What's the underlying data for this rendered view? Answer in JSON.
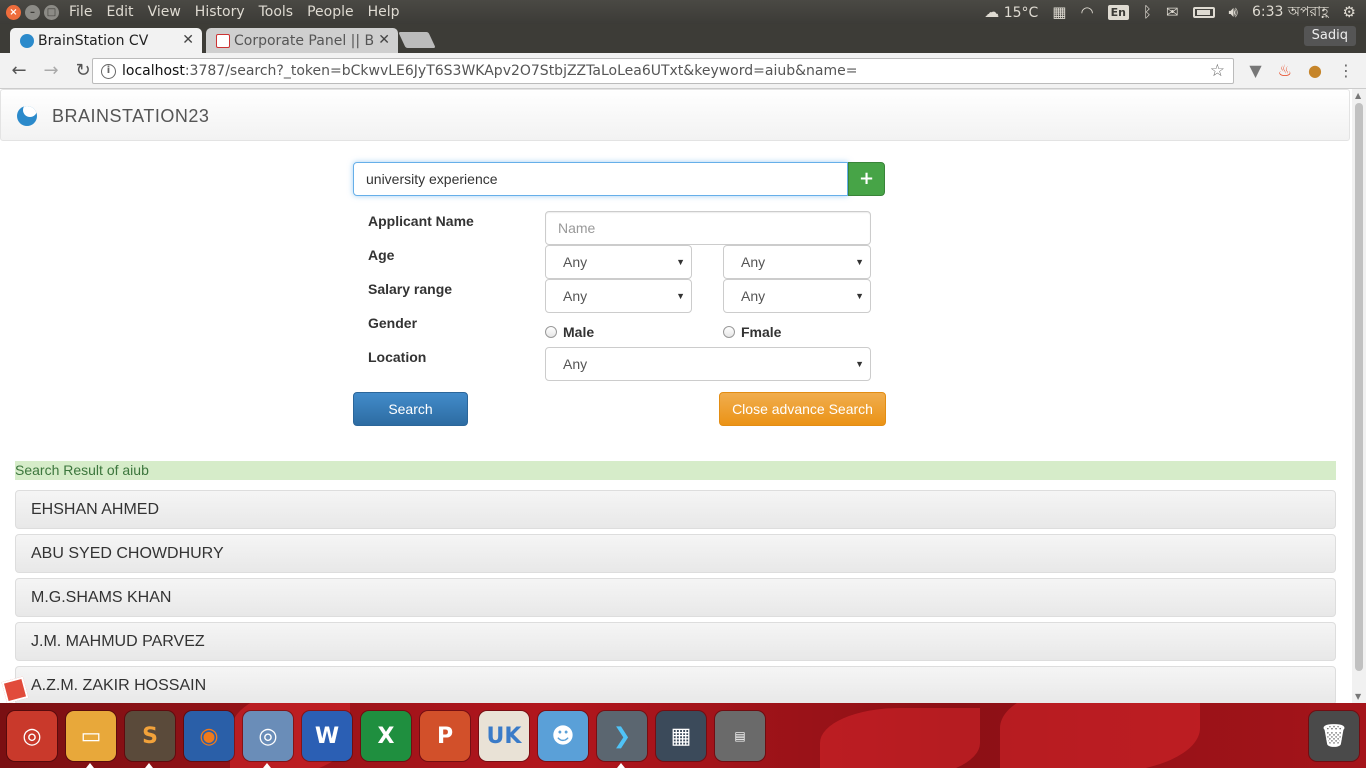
{
  "system": {
    "menus": [
      "File",
      "Edit",
      "View",
      "History",
      "Tools",
      "People",
      "Help"
    ],
    "weather": "15°C",
    "lang": "En",
    "time": "6:33 অপরাহ্ণ"
  },
  "browser": {
    "tabs": [
      {
        "title": "BrainStation CV",
        "active": true
      },
      {
        "title": "Corporate Panel || B",
        "active": false
      }
    ],
    "profile": "Sadiq",
    "url_host": "localhost",
    "url_rest": ":3787/search?_token=bCkwvLE6JyT6S3WKApv2O7StbjZZTaLoLea6UTxt&keyword=aiub&name="
  },
  "page": {
    "brand": "BRAINSTATION23",
    "search": {
      "value": "university experience",
      "add_label": "+"
    },
    "form": {
      "name_label": "Applicant Name",
      "name_placeholder": "Name",
      "age_label": "Age",
      "age_min": "Any",
      "age_max": "Any",
      "salary_label": "Salary range",
      "salary_min": "Any",
      "salary_max": "Any",
      "gender_label": "Gender",
      "gender_male": "Male",
      "gender_female": "Fmale",
      "location_label": "Location",
      "location_value": "Any",
      "search_btn": "Search",
      "close_btn": "Close advance Search"
    },
    "results_title": "Search Result of aiub",
    "results": [
      "EHSHAN AHMED",
      "ABU SYED CHOWDHURY",
      "M.G.SHAMS KHAN",
      "J.M. MAHMUD PARVEZ",
      "A.Z.M. ZAKIR HOSSAIN"
    ]
  },
  "dock": {
    "items": [
      "ubuntu-dash",
      "files",
      "sublime-text",
      "firefox",
      "chromium",
      "word",
      "excel",
      "powerpoint",
      "software-center",
      "vpn",
      "terminal",
      "workspace-switcher",
      "disk",
      "trash"
    ]
  },
  "colors": {
    "primary": "#428bca",
    "warning": "#f0ad4e",
    "success": "#47a447",
    "result_bar": "#d6ecc9"
  }
}
